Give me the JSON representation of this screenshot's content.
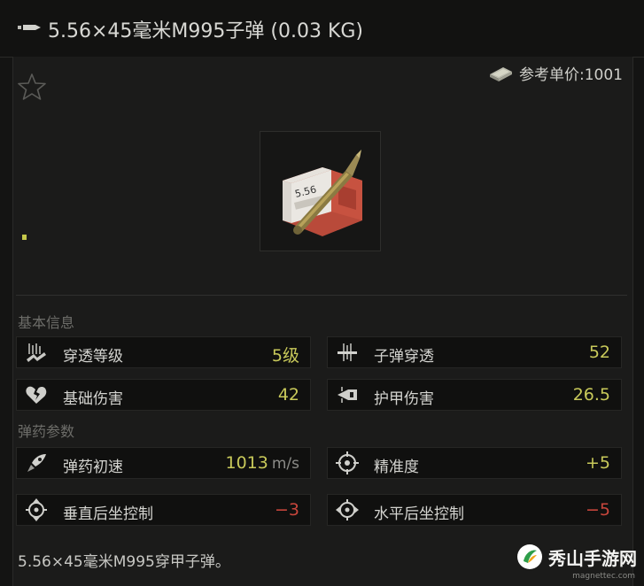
{
  "header": {
    "title": "5.56×45毫米M995子弹 (0.03 KG)",
    "icon": "bullet-icon"
  },
  "price": {
    "label": "参考单价:1001",
    "icon": "money-stack-icon"
  },
  "favorite": {
    "icon": "star-icon"
  },
  "sections": {
    "basic": "基本信息",
    "ammo": "弹药参数"
  },
  "stats": {
    "penetration_level": {
      "label": "穿透等级",
      "value": "5级",
      "icon": "penetration-level-icon"
    },
    "bullet_penetration": {
      "label": "子弹穿透",
      "value": "52",
      "icon": "bullet-penetration-icon"
    },
    "base_damage": {
      "label": "基础伤害",
      "value": "42",
      "icon": "broken-heart-icon"
    },
    "armor_damage": {
      "label": "护甲伤害",
      "value": "26.5",
      "icon": "armor-damage-icon"
    },
    "muzzle_velocity": {
      "label": "弹药初速",
      "value": "1013",
      "unit": "m/s",
      "icon": "rocket-icon"
    },
    "accuracy": {
      "label": "精准度",
      "value": "+5",
      "icon": "crosshair-icon"
    },
    "vertical_recoil": {
      "label": "垂直后坐控制",
      "value": "−3",
      "icon": "vertical-recoil-icon"
    },
    "horizontal_recoil": {
      "label": "水平后坐控制",
      "value": "−5",
      "icon": "horizontal-recoil-icon"
    }
  },
  "colors": {
    "positive": "#c8c95a",
    "negative": "#c8463c"
  },
  "description": "5.56×45毫米M995穿甲子弹。",
  "watermark": {
    "name": "秀山手游网",
    "domain": "magnettec.com"
  }
}
